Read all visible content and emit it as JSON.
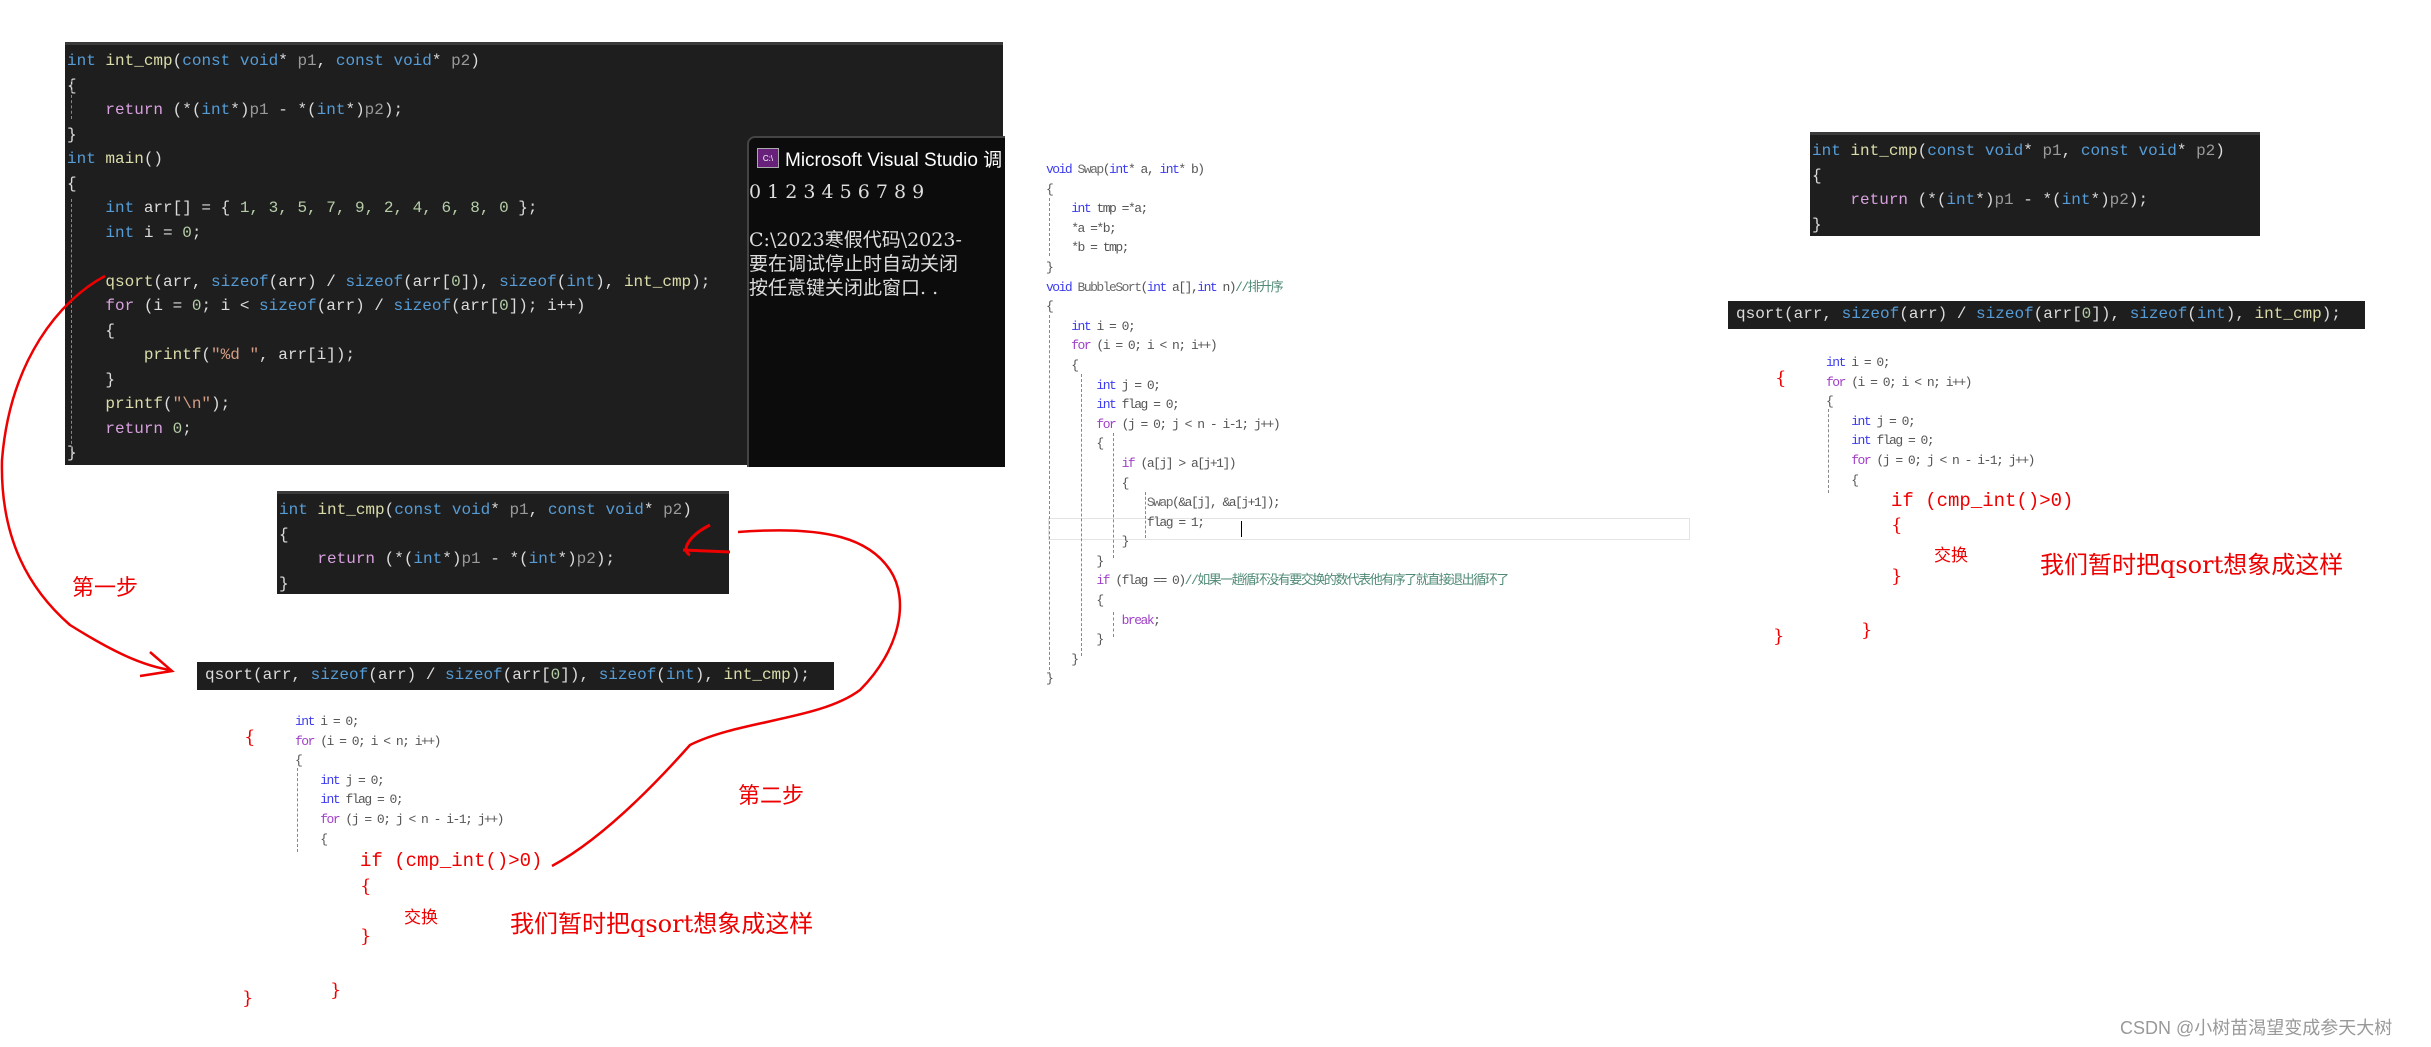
{
  "main_code": {
    "lines": [
      [
        {
          "t": "int ",
          "c": "k"
        },
        {
          "t": "int_cmp",
          "c": "f"
        },
        {
          "t": "(",
          "c": "t"
        },
        {
          "t": "const void",
          "c": "k"
        },
        {
          "t": "* ",
          "c": "t"
        },
        {
          "t": "p1",
          "c": "p"
        },
        {
          "t": ", ",
          "c": "t"
        },
        {
          "t": "const void",
          "c": "k"
        },
        {
          "t": "* ",
          "c": "t"
        },
        {
          "t": "p2",
          "c": "p"
        },
        {
          "t": ")",
          "c": "t"
        }
      ],
      [
        {
          "t": "{",
          "c": "t"
        }
      ],
      [
        {
          "t": "    ",
          "c": "t"
        },
        {
          "t": "return",
          "c": "c"
        },
        {
          "t": " (*(",
          "c": "t"
        },
        {
          "t": "int",
          "c": "k"
        },
        {
          "t": "*)",
          "c": "t"
        },
        {
          "t": "p1",
          "c": "p"
        },
        {
          "t": " - *(",
          "c": "t"
        },
        {
          "t": "int",
          "c": "k"
        },
        {
          "t": "*)",
          "c": "t"
        },
        {
          "t": "p2",
          "c": "p"
        },
        {
          "t": ");",
          "c": "t"
        }
      ],
      [
        {
          "t": "}",
          "c": "t"
        }
      ],
      [
        {
          "t": "int ",
          "c": "k"
        },
        {
          "t": "main",
          "c": "f"
        },
        {
          "t": "()",
          "c": "t"
        }
      ],
      [
        {
          "t": "{",
          "c": "t"
        }
      ],
      [
        {
          "t": "    ",
          "c": "t"
        },
        {
          "t": "int ",
          "c": "k"
        },
        {
          "t": "arr[] = { ",
          "c": "t"
        },
        {
          "t": "1, 3, 5, 7, 9, 2, 4, 6, 8, 0",
          "c": "n"
        },
        {
          "t": " };",
          "c": "t"
        }
      ],
      [
        {
          "t": "    ",
          "c": "t"
        },
        {
          "t": "int ",
          "c": "k"
        },
        {
          "t": "i = ",
          "c": "t"
        },
        {
          "t": "0",
          "c": "n"
        },
        {
          "t": ";",
          "c": "t"
        }
      ],
      [
        {
          "t": " ",
          "c": "t"
        }
      ],
      [
        {
          "t": "    ",
          "c": "t"
        },
        {
          "t": "qsort",
          "c": "f"
        },
        {
          "t": "(arr, ",
          "c": "t"
        },
        {
          "t": "sizeof",
          "c": "k"
        },
        {
          "t": "(arr) / ",
          "c": "t"
        },
        {
          "t": "sizeof",
          "c": "k"
        },
        {
          "t": "(arr[",
          "c": "t"
        },
        {
          "t": "0",
          "c": "n"
        },
        {
          "t": "]), ",
          "c": "t"
        },
        {
          "t": "sizeof",
          "c": "k"
        },
        {
          "t": "(",
          "c": "t"
        },
        {
          "t": "int",
          "c": "k"
        },
        {
          "t": "), ",
          "c": "t"
        },
        {
          "t": "int_cmp",
          "c": "f"
        },
        {
          "t": ");",
          "c": "t"
        }
      ],
      [
        {
          "t": "    ",
          "c": "t"
        },
        {
          "t": "for",
          "c": "c"
        },
        {
          "t": " (i = ",
          "c": "t"
        },
        {
          "t": "0",
          "c": "n"
        },
        {
          "t": "; i < ",
          "c": "t"
        },
        {
          "t": "sizeof",
          "c": "k"
        },
        {
          "t": "(arr) / ",
          "c": "t"
        },
        {
          "t": "sizeof",
          "c": "k"
        },
        {
          "t": "(arr[",
          "c": "t"
        },
        {
          "t": "0",
          "c": "n"
        },
        {
          "t": "]); i++)",
          "c": "t"
        }
      ],
      [
        {
          "t": "    {",
          "c": "t"
        }
      ],
      [
        {
          "t": "        ",
          "c": "t"
        },
        {
          "t": "printf",
          "c": "f"
        },
        {
          "t": "(",
          "c": "t"
        },
        {
          "t": "\"%d \"",
          "c": "s"
        },
        {
          "t": ", arr[i]);",
          "c": "t"
        }
      ],
      [
        {
          "t": "    }",
          "c": "t"
        }
      ],
      [
        {
          "t": "    ",
          "c": "t"
        },
        {
          "t": "printf",
          "c": "f"
        },
        {
          "t": "(",
          "c": "t"
        },
        {
          "t": "\"\\n\"",
          "c": "s"
        },
        {
          "t": ");",
          "c": "t"
        }
      ],
      [
        {
          "t": "    ",
          "c": "t"
        },
        {
          "t": "return",
          "c": "c"
        },
        {
          "t": " ",
          "c": "t"
        },
        {
          "t": "0",
          "c": "n"
        },
        {
          "t": ";",
          "c": "t"
        }
      ],
      [
        {
          "t": "}",
          "c": "t"
        }
      ]
    ]
  },
  "console": {
    "title": "Microsoft Visual Studio 调",
    "icon": "console-app-icon",
    "output": "0 1 2 3 4 5 6 7 8 9",
    "line2": "C:\\2023寒假代码\\2023-",
    "line3": "要在调试停止时自动关闭",
    "line4": "按任意键关闭此窗口. ."
  },
  "cmp_snippet": {
    "lines": [
      [
        {
          "t": "int ",
          "c": "k"
        },
        {
          "t": "int_cmp",
          "c": "f"
        },
        {
          "t": "(",
          "c": "t"
        },
        {
          "t": "const void",
          "c": "k"
        },
        {
          "t": "* ",
          "c": "t"
        },
        {
          "t": "p1",
          "c": "p"
        },
        {
          "t": ", ",
          "c": "t"
        },
        {
          "t": "const void",
          "c": "k"
        },
        {
          "t": "* ",
          "c": "t"
        },
        {
          "t": "p2",
          "c": "p"
        },
        {
          "t": ")",
          "c": "t"
        }
      ],
      [
        {
          "t": "{",
          "c": "t"
        }
      ],
      [
        {
          "t": "    ",
          "c": "t"
        },
        {
          "t": "return",
          "c": "c"
        },
        {
          "t": " (*(",
          "c": "t"
        },
        {
          "t": "int",
          "c": "k"
        },
        {
          "t": "*)",
          "c": "t"
        },
        {
          "t": "p1",
          "c": "p"
        },
        {
          "t": " - *(",
          "c": "t"
        },
        {
          "t": "int",
          "c": "k"
        },
        {
          "t": "*)",
          "c": "t"
        },
        {
          "t": "p2",
          "c": "p"
        },
        {
          "t": ");",
          "c": "t"
        }
      ],
      [
        {
          "t": "}",
          "c": "t"
        }
      ]
    ]
  },
  "qsort_bar": {
    "lines": [
      [
        {
          "t": "qsort",
          "c": "t"
        },
        {
          "t": "(arr, ",
          "c": "t"
        },
        {
          "t": "sizeof",
          "c": "k"
        },
        {
          "t": "(arr) / ",
          "c": "t"
        },
        {
          "t": "sizeof",
          "c": "k"
        },
        {
          "t": "(arr[",
          "c": "t"
        },
        {
          "t": "0",
          "c": "n"
        },
        {
          "t": "]), ",
          "c": "t"
        },
        {
          "t": "sizeof",
          "c": "k"
        },
        {
          "t": "(",
          "c": "t"
        },
        {
          "t": "int",
          "c": "k"
        },
        {
          "t": "), ",
          "c": "t"
        },
        {
          "t": "int_cmp",
          "c": "f"
        },
        {
          "t": ");",
          "c": "t"
        }
      ]
    ]
  },
  "loop_fragment": {
    "lines": [
      [
        {
          "t": "int ",
          "c": "k"
        },
        {
          "t": "i = 0;",
          "c": "t"
        }
      ],
      [
        {
          "t": "for",
          "c": "c"
        },
        {
          "t": " (i = 0; i < n; i++)",
          "c": "t"
        }
      ],
      [
        {
          "t": "{",
          "c": "t"
        }
      ],
      [
        {
          "t": "    ",
          "c": "t"
        },
        {
          "t": "int ",
          "c": "k"
        },
        {
          "t": "j = 0;",
          "c": "t"
        }
      ],
      [
        {
          "t": "    ",
          "c": "t"
        },
        {
          "t": "int ",
          "c": "k"
        },
        {
          "t": "flag = 0;",
          "c": "t"
        }
      ],
      [
        {
          "t": "    ",
          "c": "t"
        },
        {
          "t": "for",
          "c": "c"
        },
        {
          "t": " (j = 0; j < n - i-1; j++)",
          "c": "t"
        }
      ],
      [
        {
          "t": "    {",
          "c": "t"
        }
      ]
    ]
  },
  "bubble_code": {
    "lines": [
      [
        {
          "t": "void ",
          "c": "k"
        },
        {
          "t": "Swap",
          "c": "f"
        },
        {
          "t": "(",
          "c": "t"
        },
        {
          "t": "int",
          "c": "k"
        },
        {
          "t": "* a, ",
          "c": "t"
        },
        {
          "t": "int",
          "c": "k"
        },
        {
          "t": "* b)",
          "c": "t"
        }
      ],
      [
        {
          "t": "{",
          "c": "t"
        }
      ],
      [
        {
          "t": "    ",
          "c": "t"
        },
        {
          "t": "int ",
          "c": "k"
        },
        {
          "t": "tmp =*a;",
          "c": "t"
        }
      ],
      [
        {
          "t": "    *a =*b;",
          "c": "t"
        }
      ],
      [
        {
          "t": "    *b = tmp;",
          "c": "t"
        }
      ],
      [
        {
          "t": "}",
          "c": "t"
        }
      ],
      [
        {
          "t": "void ",
          "c": "k"
        },
        {
          "t": "BubbleSort",
          "c": "f"
        },
        {
          "t": "(",
          "c": "t"
        },
        {
          "t": "int",
          "c": "k"
        },
        {
          "t": " a[],",
          "c": "t"
        },
        {
          "t": "int",
          "c": "k"
        },
        {
          "t": " n)",
          "c": "t"
        },
        {
          "t": "//排升序",
          "c": "m"
        }
      ],
      [
        {
          "t": "{",
          "c": "t"
        }
      ],
      [
        {
          "t": "    ",
          "c": "t"
        },
        {
          "t": "int ",
          "c": "k"
        },
        {
          "t": "i = 0;",
          "c": "t"
        }
      ],
      [
        {
          "t": "    ",
          "c": "t"
        },
        {
          "t": "for",
          "c": "c"
        },
        {
          "t": " (i = 0; i < n; i++)",
          "c": "t"
        }
      ],
      [
        {
          "t": "    {",
          "c": "t"
        }
      ],
      [
        {
          "t": "        ",
          "c": "t"
        },
        {
          "t": "int ",
          "c": "k"
        },
        {
          "t": "j = 0;",
          "c": "t"
        }
      ],
      [
        {
          "t": "        ",
          "c": "t"
        },
        {
          "t": "int ",
          "c": "k"
        },
        {
          "t": "flag = 0;",
          "c": "t"
        }
      ],
      [
        {
          "t": "        ",
          "c": "t"
        },
        {
          "t": "for",
          "c": "c"
        },
        {
          "t": " (j = 0; j < n - i-1; j++)",
          "c": "t"
        }
      ],
      [
        {
          "t": "        {",
          "c": "t"
        }
      ],
      [
        {
          "t": "            ",
          "c": "t"
        },
        {
          "t": "if",
          "c": "c"
        },
        {
          "t": " (a[j] > a[j+1])",
          "c": "t"
        }
      ],
      [
        {
          "t": "            {",
          "c": "t"
        }
      ],
      [
        {
          "t": "                ",
          "c": "t"
        },
        {
          "t": "Swap",
          "c": "f"
        },
        {
          "t": "(&a[j], &a[j+1]);",
          "c": "t"
        }
      ],
      [
        {
          "t": "                flag = 1;",
          "c": "t"
        }
      ],
      [
        {
          "t": "            }",
          "c": "t"
        }
      ],
      [
        {
          "t": "        }",
          "c": "t"
        }
      ],
      [
        {
          "t": "        ",
          "c": "t"
        },
        {
          "t": "if",
          "c": "c"
        },
        {
          "t": " (flag == 0)",
          "c": "t"
        },
        {
          "t": "//如果一趟循环没有要交换的数代表他有序了就直接退出循环了",
          "c": "m"
        }
      ],
      [
        {
          "t": "        {",
          "c": "t"
        }
      ],
      [
        {
          "t": "            ",
          "c": "t"
        },
        {
          "t": "break",
          "c": "c"
        },
        {
          "t": ";",
          "c": "t"
        }
      ],
      [
        {
          "t": "        }",
          "c": "t"
        }
      ],
      [
        {
          "t": "    }",
          "c": "t"
        }
      ],
      [
        {
          "t": "}",
          "c": "t"
        }
      ]
    ]
  },
  "annotations": {
    "step1": "第一步",
    "step2": "第二步",
    "open_brace": "{",
    "close_brace": "}",
    "if_cmp": "if (cmp_int()>0)",
    "swap": "交换",
    "note": "我们暂时把qsort想象成这样",
    "color": "#e00000"
  },
  "colors": {
    "editor_bg": "#1e1e1e",
    "keyword": "#569cd6",
    "function": "#dcdcaa",
    "control": "#d8a0df",
    "annotation": "#e00000"
  },
  "watermark": "CSDN @小树苗渴望变成参天大树"
}
